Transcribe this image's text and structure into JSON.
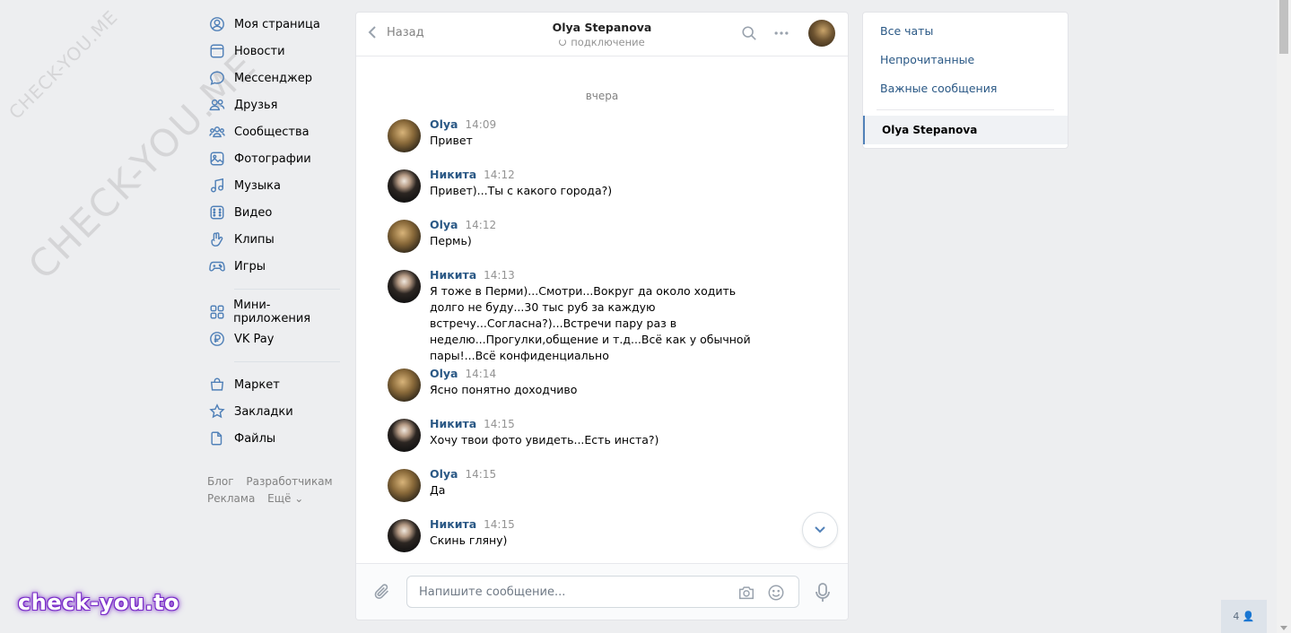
{
  "watermarks": {
    "diagonal_small": "CHECK-YOU.ME",
    "diagonal_large": "CHECK-YOU.ME",
    "bottom": "check-you.to"
  },
  "left_nav": {
    "items": [
      {
        "label": "Моя страница",
        "icon": "user-circle-icon"
      },
      {
        "label": "Новости",
        "icon": "news-icon"
      },
      {
        "label": "Мессенджер",
        "icon": "message-icon"
      },
      {
        "label": "Друзья",
        "icon": "friends-icon"
      },
      {
        "label": "Сообщества",
        "icon": "communities-icon"
      },
      {
        "label": "Фотографии",
        "icon": "photo-icon"
      },
      {
        "label": "Музыка",
        "icon": "music-icon"
      },
      {
        "label": "Видео",
        "icon": "video-icon"
      },
      {
        "label": "Клипы",
        "icon": "clips-icon"
      },
      {
        "label": "Игры",
        "icon": "gamepad-icon"
      }
    ],
    "items2": [
      {
        "label": "Мини-приложения",
        "icon": "apps-icon"
      },
      {
        "label": "VK Pay",
        "icon": "vkpay-icon"
      }
    ],
    "items3": [
      {
        "label": "Маркет",
        "icon": "market-icon"
      },
      {
        "label": "Закладки",
        "icon": "bookmark-icon"
      },
      {
        "label": "Файлы",
        "icon": "file-icon"
      }
    ],
    "footer": {
      "blog": "Блог",
      "dev": "Разработчикам",
      "ads": "Реклама",
      "more": "Ещё ⌄"
    }
  },
  "chat": {
    "back_label": "Назад",
    "peer_name": "Olya Stepanova",
    "peer_status": "подключение",
    "day_separator": "вчера",
    "messages": [
      {
        "author": "Olya",
        "time": "14:09",
        "text": "Привет",
        "who": "olya"
      },
      {
        "author": "Никита",
        "time": "14:12",
        "text": "Привет)...Ты с какого города?)",
        "who": "nik"
      },
      {
        "author": "Olya",
        "time": "14:12",
        "text": "Пермь)",
        "who": "olya"
      },
      {
        "author": "Никита",
        "time": "14:13",
        "text": "Я тоже в Перми)...Смотри...Вокруг да около ходить долго не буду...30 тыс руб за каждую встречу...Согласна?)...Встречи пару раз в неделю...Прогулки,общение и т.д...Всё как у обычной пары!...Всё конфиденциально",
        "who": "nik"
      },
      {
        "author": "Olya",
        "time": "14:14",
        "text": "Ясно понятно доходчиво",
        "who": "olya"
      },
      {
        "author": "Никита",
        "time": "14:15",
        "text": "Хочу твои фото увидеть...Есть инста?)",
        "who": "nik"
      },
      {
        "author": "Olya",
        "time": "14:15",
        "text": "Да",
        "who": "olya"
      },
      {
        "author": "Никита",
        "time": "14:15",
        "text": "Скинь гляну)",
        "who": "nik"
      }
    ],
    "composer_placeholder": "Напишите сообщение..."
  },
  "right_panel": {
    "all_chats": "Все чаты",
    "unread": "Непрочитанные",
    "important": "Важные сообщения",
    "active_chat": "Olya Stepanova"
  },
  "online_badge": "4 👤"
}
